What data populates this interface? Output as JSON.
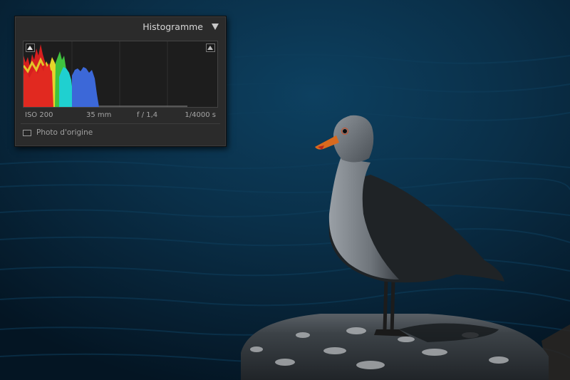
{
  "panel": {
    "title": "Histogramme",
    "exif": {
      "iso": "ISO 200",
      "focal_length": "35 mm",
      "aperture": "f / 1,4",
      "shutter": "1/4000 s"
    },
    "original_photo_label": "Photo d'origine",
    "original_photo_checked": false
  },
  "icons": {
    "collapse": "triangle-down-icon",
    "shadow_clipping": "triangle-up-icon",
    "highlight_clipping": "triangle-up-icon",
    "checkbox": "checkbox-icon"
  },
  "colors": {
    "panel_bg": "#2b2b2b",
    "histogram_bg": "#1d1d1d",
    "red_channel": "#e02020",
    "yellow_channel": "#e6d52a",
    "green_channel": "#3fc23f",
    "cyan_channel": "#1fd0d0",
    "blue_channel": "#3c68d8",
    "luminance": "#9c9c9c",
    "water": "#0a3550"
  }
}
